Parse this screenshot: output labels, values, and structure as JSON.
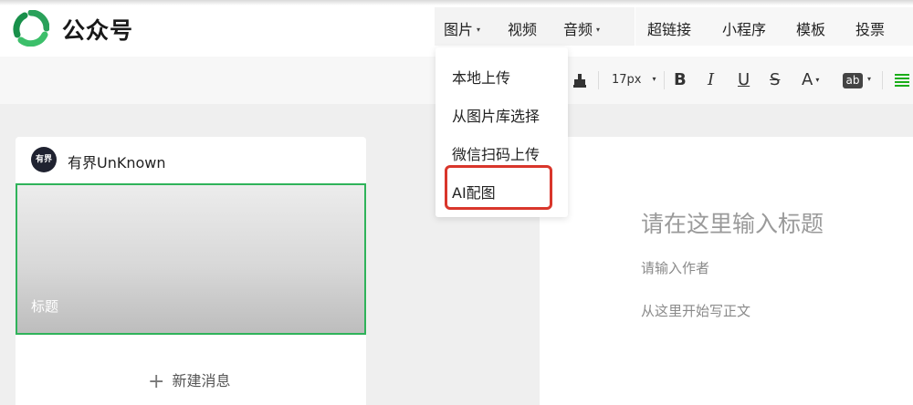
{
  "app": {
    "title": "公众号"
  },
  "nav": {
    "items": [
      {
        "label": "图片",
        "caret": "▾"
      },
      {
        "label": "视频"
      },
      {
        "label": "音频",
        "caret": "▾"
      },
      {
        "label": "超链接"
      },
      {
        "label": "小程序"
      },
      {
        "label": "模板"
      },
      {
        "label": "投票"
      }
    ]
  },
  "dropdown": {
    "items": [
      {
        "label": "本地上传"
      },
      {
        "label": "从图片库选择"
      },
      {
        "label": "微信扫码上传"
      },
      {
        "label": "AI配图",
        "highlighted": true
      }
    ],
    "highlight_color": "#d9362b"
  },
  "toolbar": {
    "font_size": "17px",
    "bold": "B",
    "italic": "I",
    "underline": "U",
    "strike": "S",
    "font_color": "A",
    "bg_color": "ab"
  },
  "account": {
    "name": "有界UnKnown",
    "avatar_text": "有界"
  },
  "article": {
    "cover_title": "标题",
    "accent": "#2fb35a"
  },
  "new_message": {
    "label": "新建消息"
  },
  "editor": {
    "title_placeholder": "请在这里输入标题",
    "author_placeholder": "请输入作者",
    "body_placeholder": "从这里开始写正文"
  },
  "colors": {
    "brand_green": "#1aad19",
    "accent_green": "#2fb35a"
  }
}
